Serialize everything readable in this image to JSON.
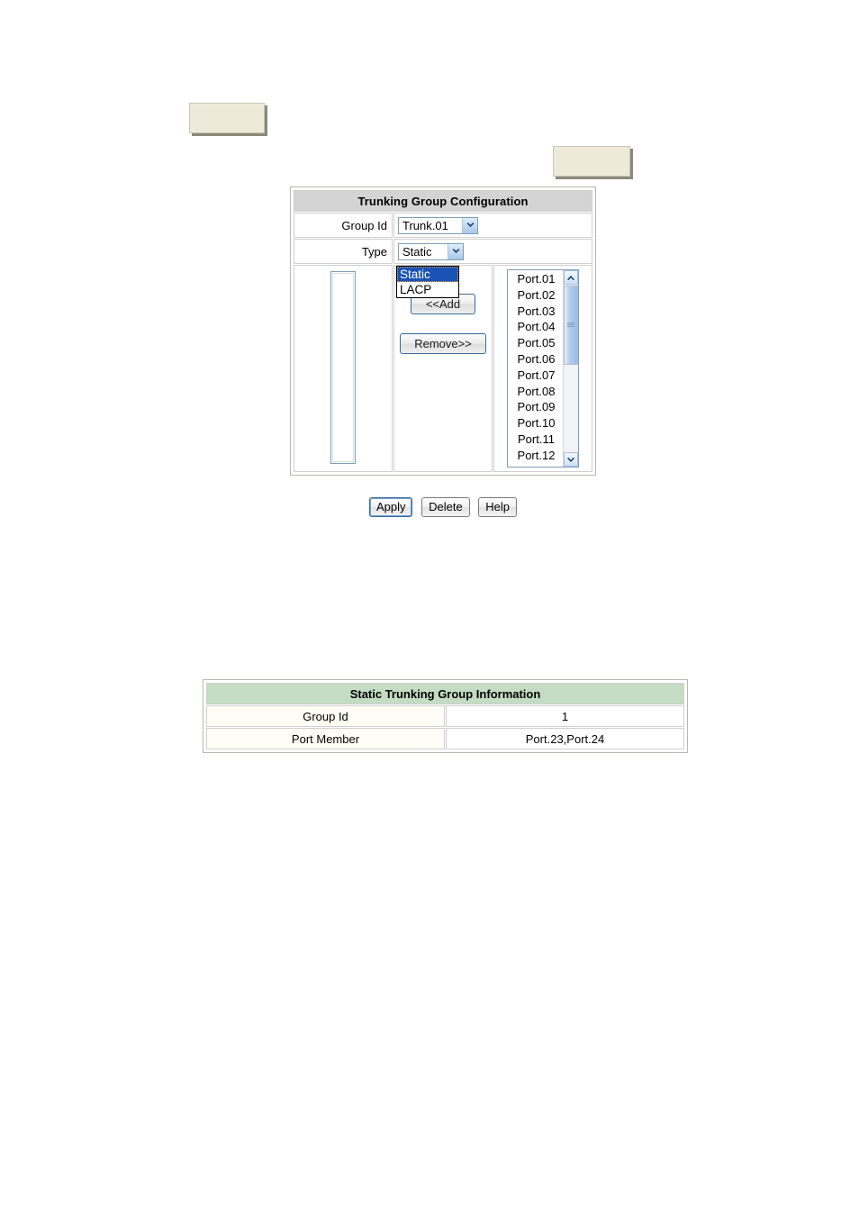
{
  "blanks": {
    "top_left": "",
    "top_right": ""
  },
  "config": {
    "header": "Trunking Group Configuration",
    "rows": [
      {
        "label": "Group Id",
        "value": "Trunk.01"
      },
      {
        "label": "Type",
        "value": "Static"
      }
    ],
    "group_id": {
      "label": "Group Id",
      "selected": "Trunk.01"
    },
    "type": {
      "label": "Type",
      "selected": "Static",
      "open": true,
      "options": [
        {
          "label": "Static",
          "selected": true
        },
        {
          "label": "LACP",
          "selected": false
        }
      ]
    },
    "member_list": {
      "items": []
    },
    "transfer_buttons": {
      "add": "<<Add",
      "remove": "Remove>>"
    },
    "port_list": {
      "items": [
        "Port.01",
        "Port.02",
        "Port.03",
        "Port.04",
        "Port.05",
        "Port.06",
        "Port.07",
        "Port.08",
        "Port.09",
        "Port.10",
        "Port.11",
        "Port.12"
      ],
      "scroll_up_icon": "caret-up-icon",
      "scroll_down_icon": "caret-down-icon"
    }
  },
  "actions": {
    "apply": "Apply",
    "delete": "Delete",
    "help": "Help"
  },
  "info": {
    "header": "Static Trunking Group Information",
    "rows": [
      {
        "label": "Group Id",
        "value": "1"
      },
      {
        "label": "Port Member",
        "value": "Port.23,Port.24"
      }
    ]
  },
  "colors": {
    "config_header_bg": "#d4d4d4",
    "info_header_bg": "#c3dcc3",
    "info_label_bg": "#fffdf5",
    "dropdown_highlight": "#1a52b5",
    "blank_box_bg": "#edead9"
  }
}
